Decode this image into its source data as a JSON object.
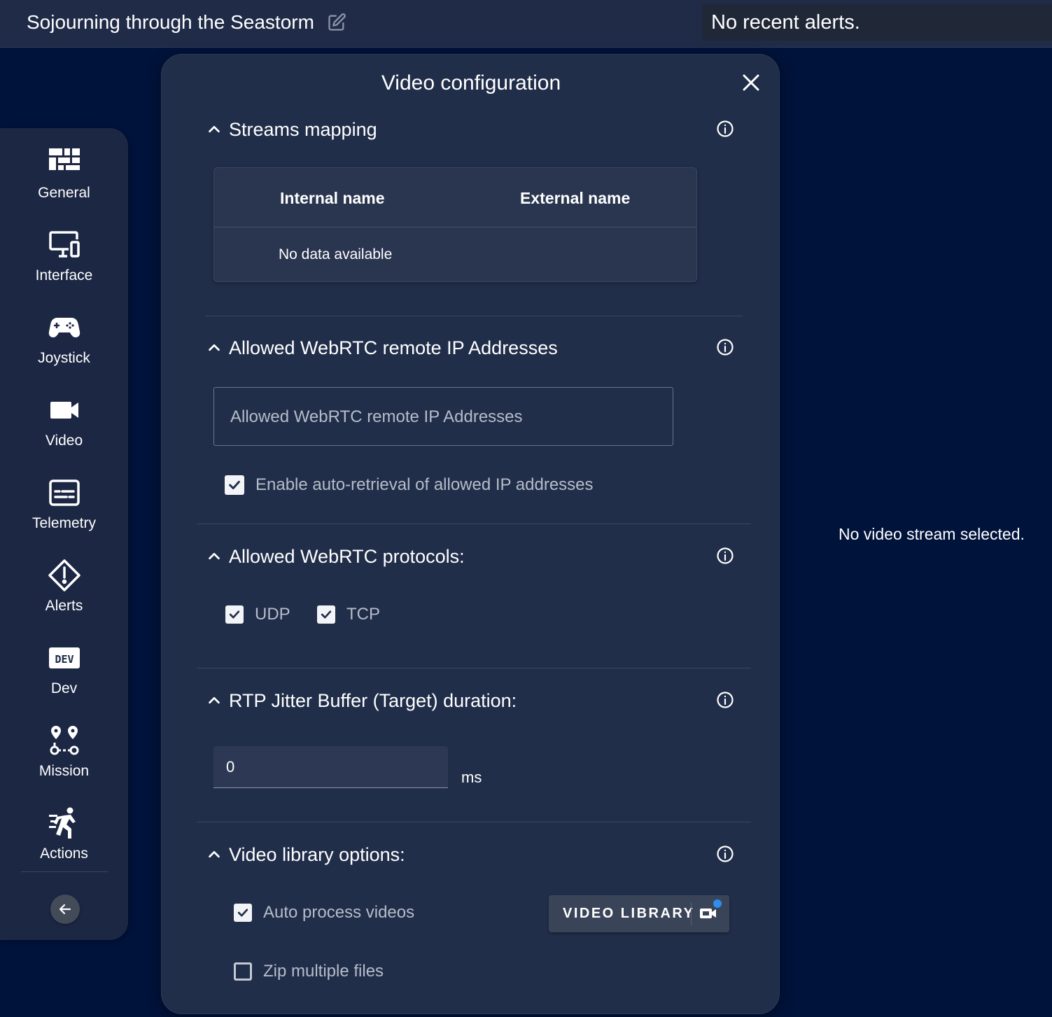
{
  "topbar": {
    "mission_name": "Sojourning through the Seastorm",
    "alerts_text": "No recent alerts."
  },
  "main": {
    "no_video_text": "No video stream selected."
  },
  "sidebar": {
    "items": [
      {
        "label": "General",
        "icon": "dashboard-icon"
      },
      {
        "label": "Interface",
        "icon": "devices-icon"
      },
      {
        "label": "Joystick",
        "icon": "gamepad-icon"
      },
      {
        "label": "Video",
        "icon": "video-camera-icon"
      },
      {
        "label": "Telemetry",
        "icon": "subtitles-icon"
      },
      {
        "label": "Alerts",
        "icon": "alert-diamond-icon"
      },
      {
        "label": "Dev",
        "icon": "dev-icon"
      },
      {
        "label": "Mission",
        "icon": "map-marker-path-icon"
      },
      {
        "label": "Actions",
        "icon": "run-fast-icon"
      }
    ],
    "dev_badge": "DEV"
  },
  "dialog": {
    "title": "Video configuration",
    "sections": {
      "streams": {
        "title": "Streams mapping",
        "columns": [
          "Internal name",
          "External name"
        ],
        "empty_text": "No data available"
      },
      "ip": {
        "title": "Allowed WebRTC remote IP Addresses",
        "placeholder": "Allowed WebRTC remote IP Addresses",
        "auto_retrieval_label": "Enable auto-retrieval of allowed IP addresses",
        "auto_retrieval_checked": true
      },
      "protocols": {
        "title": "Allowed WebRTC protocols:",
        "options": [
          {
            "label": "UDP",
            "checked": true
          },
          {
            "label": "TCP",
            "checked": true
          }
        ]
      },
      "jitter": {
        "title": "RTP Jitter Buffer (Target) duration:",
        "value": "0",
        "unit": "ms"
      },
      "library": {
        "title": "Video library options:",
        "auto_process_label": "Auto process videos",
        "auto_process_checked": true,
        "zip_label": "Zip multiple files",
        "zip_checked": false,
        "button_label": "VIDEO LIBRARY"
      }
    }
  },
  "colors": {
    "background": "#00133b",
    "panel": "#212e4a",
    "sidebar": "#1c2744",
    "notification_dot": "#2f8df0"
  }
}
